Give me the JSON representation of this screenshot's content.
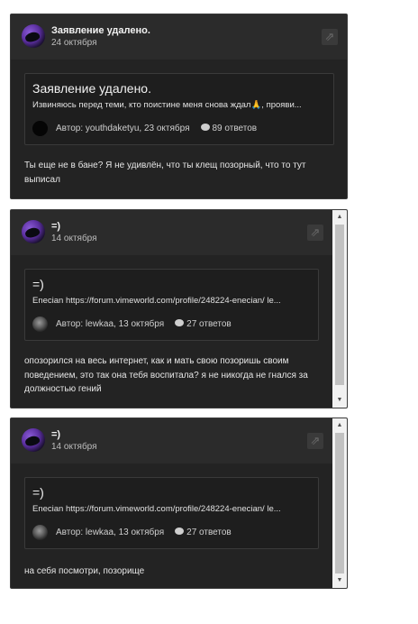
{
  "posts": [
    {
      "title": "Заявление удалено.",
      "date": "24 октября",
      "quote": {
        "title": "Заявление удалено.",
        "text": "Извиняюсь перед теми, кто поистине меня снова ждал🙏, прояви...",
        "author_line": "Автор: youthdaketyu, 23 октября",
        "replies": "89 ответов"
      },
      "body": "Ты еще не в бане? Я не удивлён, что ты клещ позорный, что то тут выписал"
    },
    {
      "title": "=)",
      "date": "14 октября",
      "quote": {
        "title": "=)",
        "text": "Enecian https://forum.vimeworld.com/profile/248224-enecian/ le...",
        "author_line": "Автор: lewkaa, 13 октября",
        "replies": "27 ответов"
      },
      "body": "опозорился на весь интернет, как и мать свою позоришь своим поведением, это так она тебя воспитала? я не никогда не гнался за должностью гений"
    },
    {
      "title": "=)",
      "date": "14 октября",
      "quote": {
        "title": "=)",
        "text": "Enecian https://forum.vimeworld.com/profile/248224-enecian/ le...",
        "author_line": "Автор: lewkaa, 13 октября",
        "replies": "27 ответов"
      },
      "body": "на себя посмотри, позорище"
    }
  ],
  "icons": {
    "share": "external-link-icon",
    "comments": "comment-bubble-icon",
    "scroll_up": "arrow-up-icon",
    "scroll_down": "arrow-down-icon"
  },
  "colors": {
    "card_bg": "#232323",
    "header_bg": "#2b2b2b",
    "text": "#e6e6e6"
  }
}
